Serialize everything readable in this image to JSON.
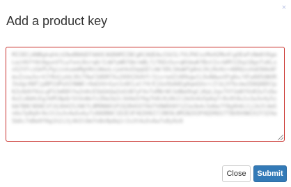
{
  "dialog": {
    "title": "Add a product key",
    "close_icon": "close-icon",
    "close_glyph": "×"
  },
  "product_key": {
    "value": "MIIBIjANBgkqhkiG9w0BAQEFAAOCAQ8AMIIBCgKCAQEAu1SU1LfVLPHCozMxH2Mo4lgOEePzNm0tRgeLezV6ffAt0gunVTLw7onLRnrq0/IzW7yWR7QkrmBL7jTKEn5u+qKhbwKfBstIs+bMY2Zkp18gnTxKLxoS2tFczGkPLPgizskuemMghRniWaoLcyehkd3qqGElvW/VDL5AaWTg0nLVkjRo9z+40RQzuVaE8AkAFmxZzow3x+VJYKdjykkJ0iT9wCS0DRTXu269V264Vf/3jvredZiKRkgwlL9xNAwxXFg0x/XFw005UWVRIkdgcKWTjpBP2dPwVZ4WWC+9aGVd+Gyn1o0CLelf4rEjGoXbAAEgAqeGUxrcIlbjXfbcmwIDAQABX1pKZx9dVf6sLqP3JmR8tYw2nHcE5bGkQaZoUiN7yF4vTxM0rWlSdBeOhgCjKpL2qs7VY1m8fXnR3uTzDw6oIiAbHcEgJkMlNpQrStUvWxYzZ0a1b2c3d4e5f6g7h8i9j0k1l2m3n4o5p6q7r8s9t0u1v2w3x4y5z6A7B8C9D0E1F2G3H4I5J6K7L8M9N0O1P2Q3R4S5T6U7V8W9X0Y1Z2a3b4c5d6e7f8g9h0i1j2k3l4m5n6o7p8q9r0s1t2u3v4w5x6y7z8A9B0C1D2E3F4G5H6I7J8K9L0M1N2O3P4Q5R6S7T8U9V0W1X2Y3Z4a5b6c7d8e9f0g1h2i3j4k5l6m7n8o9p0q1r2s3t4u5v6w7x8y9z0"
  },
  "buttons": {
    "close_label": "Close",
    "submit_label": "Submit"
  },
  "colors": {
    "submit_bg": "#337ab7",
    "textarea_border_error": "#c9302c"
  }
}
